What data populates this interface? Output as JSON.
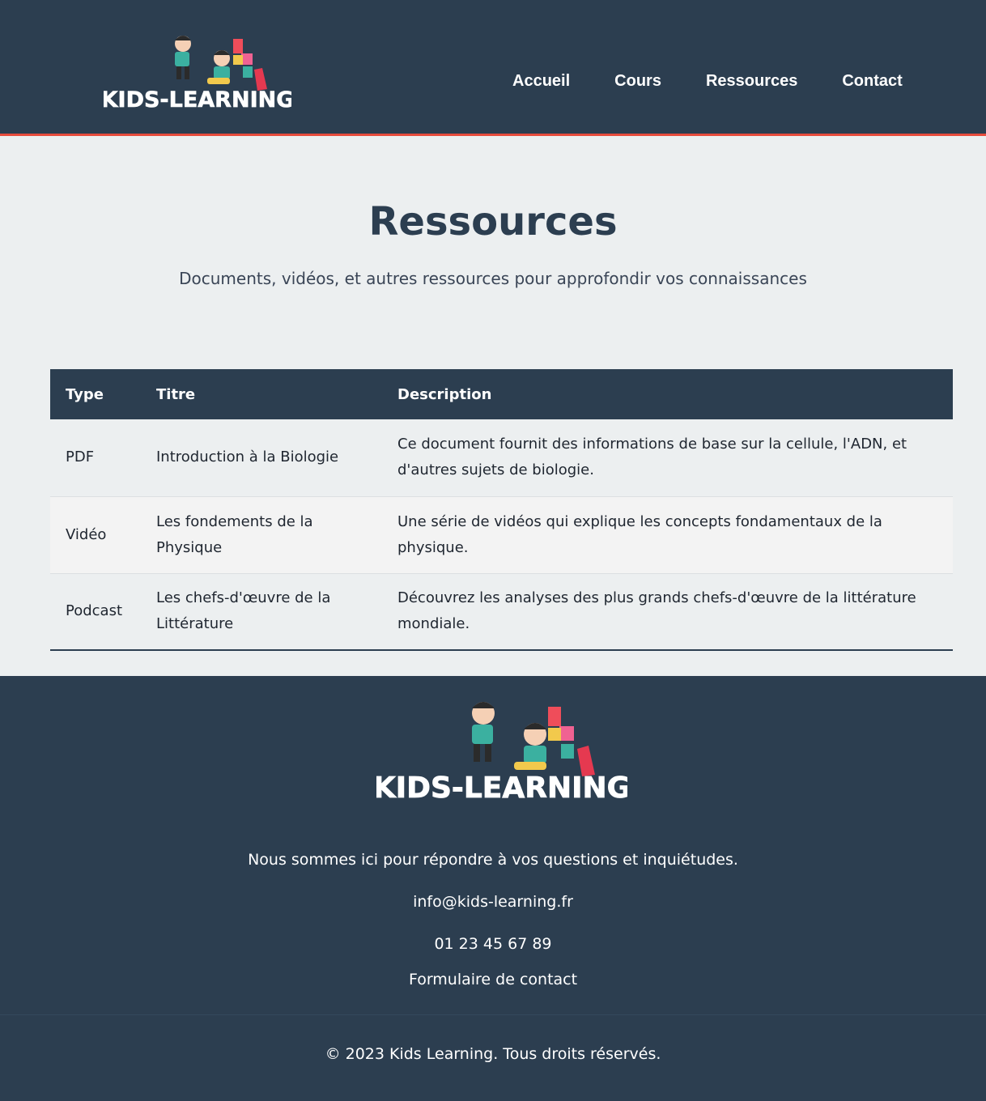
{
  "header": {
    "logo_text": "KIDS-LEARNING",
    "nav": [
      "Accueil",
      "Cours",
      "Ressources",
      "Contact"
    ]
  },
  "hero": {
    "title": "Ressources",
    "subtitle": "Documents, vidéos, et autres ressources pour approfondir vos connaissances"
  },
  "table": {
    "headers": [
      "Type",
      "Titre",
      "Description"
    ],
    "rows": [
      {
        "type": "PDF",
        "title": "Introduction à la Biologie",
        "description": "Ce document fournit des informations de base sur la cellule, l'ADN, et d'autres sujets de biologie."
      },
      {
        "type": "Vidéo",
        "title": "Les fondements de la Physique",
        "description": "Une série de vidéos qui explique les concepts fondamentaux de la physique."
      },
      {
        "type": "Podcast",
        "title": "Les chefs-d'œuvre de la Littérature",
        "description": "Découvrez les analyses des plus grands chefs-d'œuvre de la littérature mondiale."
      }
    ]
  },
  "footer": {
    "logo_text": "KIDS-LEARNING",
    "message": "Nous sommes ici pour répondre à vos questions et inquiétudes.",
    "email": "info@kids-learning.fr",
    "phone": "01 23 45 67 89",
    "form_link": "Formulaire de contact",
    "copyright": "© 2023 Kids Learning. Tous droits réservés."
  },
  "colors": {
    "primary": "#2c3e50",
    "accent": "#e74c3c",
    "background": "#eceff0"
  }
}
